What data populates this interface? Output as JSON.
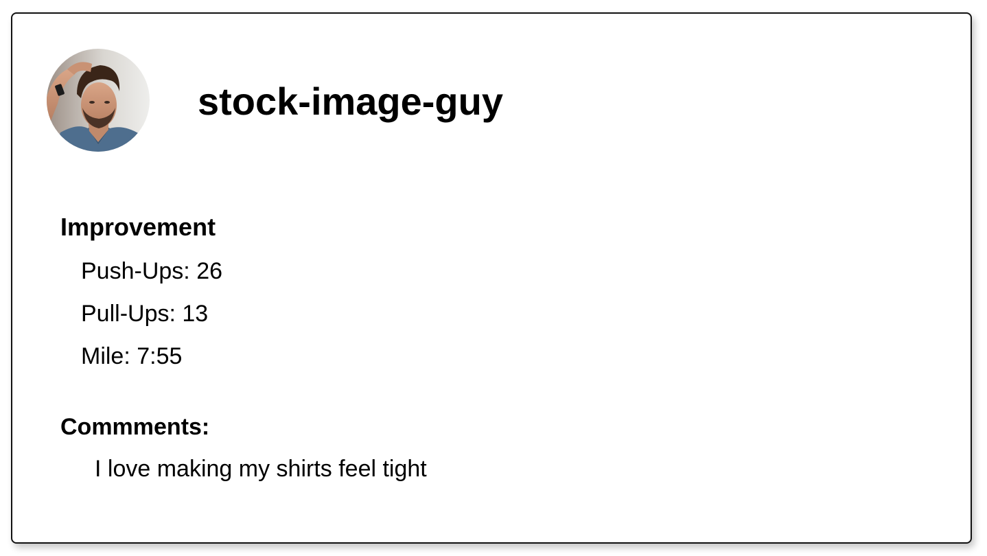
{
  "profile": {
    "username": "stock-image-guy",
    "avatar_icon": "user-avatar-photo"
  },
  "improvement": {
    "title": "Improvement",
    "stats": [
      {
        "label": "Push-Ups",
        "value": "26"
      },
      {
        "label": "Pull-Ups",
        "value": "13"
      },
      {
        "label": "Mile",
        "value": "7:55"
      }
    ]
  },
  "comments": {
    "title": "Commments:",
    "text": "I love making my shirts feel tight"
  },
  "colors": {
    "card_border": "#111111",
    "background": "#ffffff",
    "text": "#000000"
  }
}
